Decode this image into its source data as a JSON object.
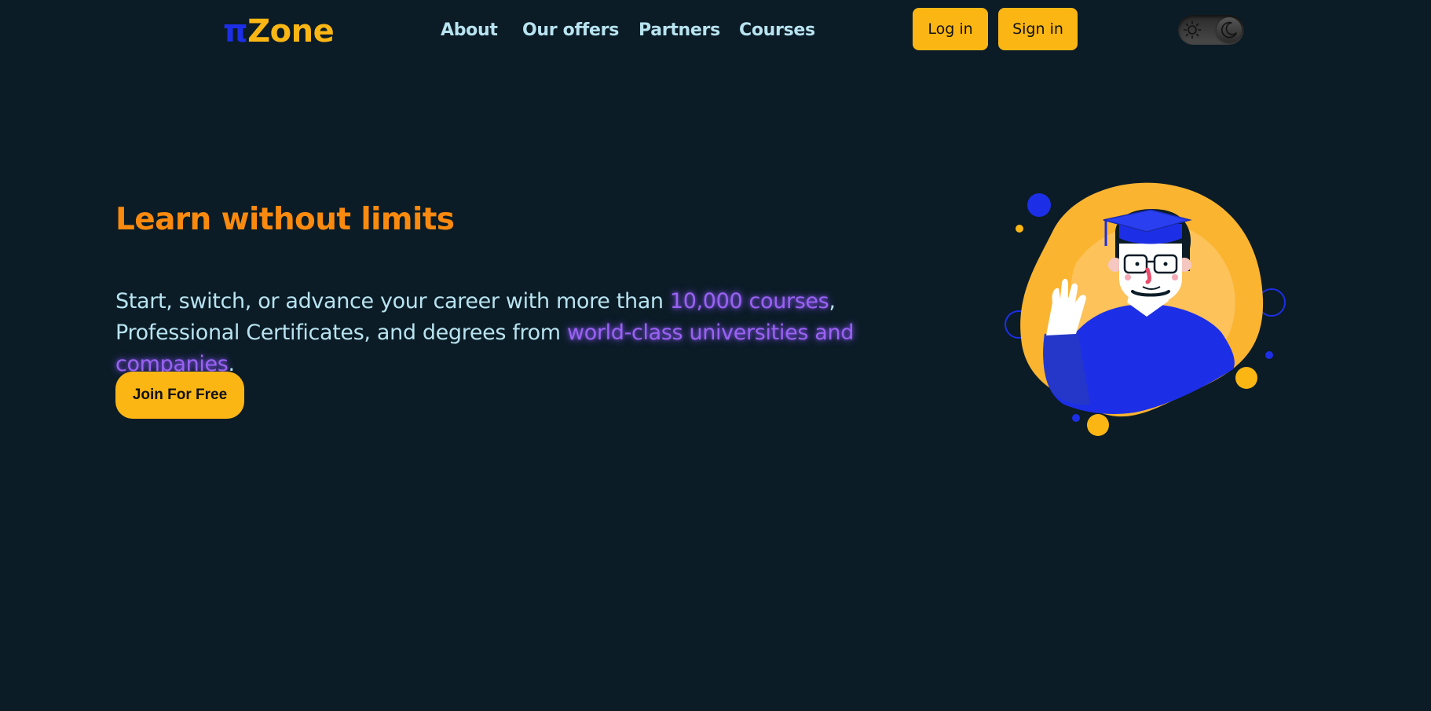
{
  "header": {
    "logo": {
      "pi": "π",
      "zone": "Zone"
    },
    "nav": [
      "About",
      "Our offers",
      "Partners",
      "Courses"
    ],
    "login_label": "Log in",
    "signin_label": "Sign in",
    "theme_toggle": {
      "state": "dark",
      "icons": [
        "sun-icon",
        "moon-icon"
      ]
    }
  },
  "hero": {
    "title": "Learn without limits",
    "text_1": "Start, switch, or advance your career with more than ",
    "highlight_1": "10,000 courses",
    "text_2": ", Professional Certificates, and degrees from ",
    "highlight_2": "world-class universities and companies",
    "text_3": ".",
    "cta_label": "Join For Free"
  },
  "colors": {
    "background": "#0b1c26",
    "accent": "#fbb614",
    "title": "#fa8a0f",
    "text": "#b8e3f0",
    "highlight": "#9a62f2",
    "pi_blue": "#1d2fe6"
  }
}
